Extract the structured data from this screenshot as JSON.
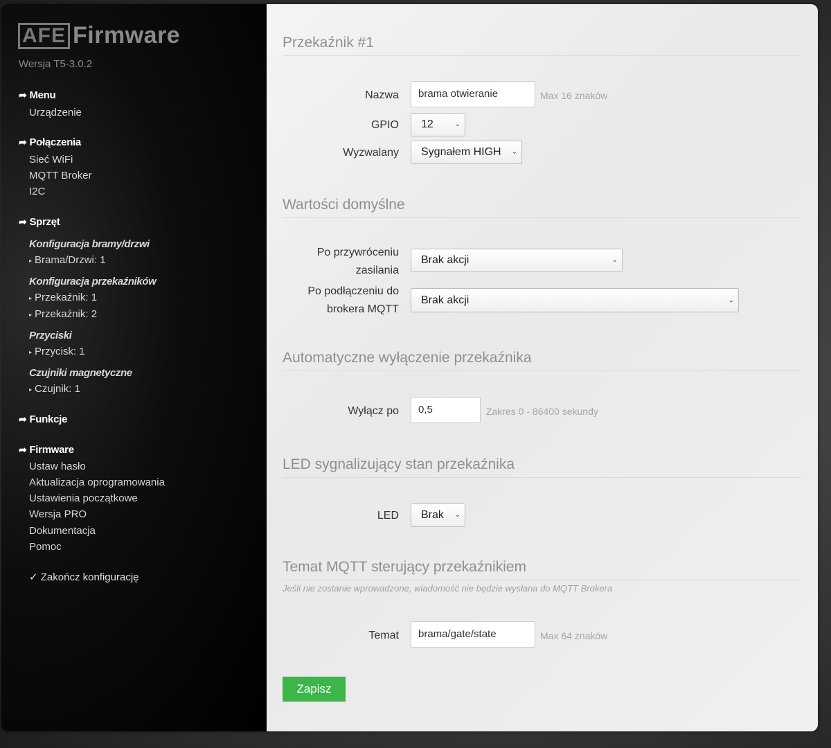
{
  "brand": {
    "logo_box": "AFE",
    "logo_text": "Firmware",
    "version": "Wersja T5-3.0.2"
  },
  "sidebar": {
    "menu_head": "Menu",
    "menu_items": [
      "Urządzenie"
    ],
    "connections_head": "Połączenia",
    "connections_items": [
      "Sieć WiFi",
      "MQTT Broker",
      "I2C"
    ],
    "hardware_head": "Sprzęt",
    "gate_config": "Konfiguracja bramy/drzwi",
    "gate_items": [
      "Brama/Drzwi: 1"
    ],
    "relay_config": "Konfiguracja przekaźników",
    "relay_items": [
      "Przekaźnik: 1",
      "Przekaźnik: 2"
    ],
    "buttons_config": "Przyciski",
    "buttons_items": [
      "Przycisk: 1"
    ],
    "sensors_config": "Czujniki magnetyczne",
    "sensors_items": [
      "Czujnik: 1"
    ],
    "functions_head": "Funkcje",
    "firmware_head": "Firmware",
    "firmware_items": [
      "Ustaw hasło",
      "Aktualizacja oprogramowania",
      "Ustawienia początkowe",
      "Wersja PRO",
      "Dokumentacja",
      "Pomoc"
    ],
    "finish": "Zakończ konfigurację"
  },
  "form": {
    "relay_title": "Przekaźnik #1",
    "name_label": "Nazwa",
    "name_value": "brama otwieranie",
    "name_hint": "Max 16 znaków",
    "gpio_label": "GPIO",
    "gpio_value": "12",
    "trigger_label": "Wyzwalany",
    "trigger_value": "Sygnałem HIGH",
    "defaults_title": "Wartości domyślne",
    "power_restore_label_1": "Po przywróceniu",
    "power_restore_label_2": "zasilania",
    "power_restore_value": "Brak akcji",
    "mqtt_connect_label_1": "Po podłączeniu do",
    "mqtt_connect_label_2": "brokera MQTT",
    "mqtt_connect_value": "Brak akcji",
    "auto_off_title": "Automatyczne wyłączenie przekaźnika",
    "off_after_label": "Wyłącz po",
    "off_after_value": "0,5",
    "off_after_hint": "Zakres 0 - 86400 sekundy",
    "led_title": "LED sygnalizujący stan przekaźnika",
    "led_label": "LED",
    "led_value": "Brak",
    "mqtt_title": "Temat MQTT sterujący przekaźnikiem",
    "mqtt_note": "Jeśli nie zostanie wprowadzone, wiadomość nie będzie wysłana do MQTT Brokera",
    "topic_label": "Temat",
    "topic_value": "brama/gate/state",
    "topic_hint": "Max 64 znaków",
    "save_label": "Zapisz"
  },
  "colors": {
    "save_button": "#3cb549",
    "sidebar_bg": "#000000"
  },
  "icons": {
    "nav_arrow": "arrow-right-icon",
    "finish_check": "check-icon",
    "bullet": "triangle-bullet-icon",
    "select_chevron": "chevron-down-icon"
  }
}
